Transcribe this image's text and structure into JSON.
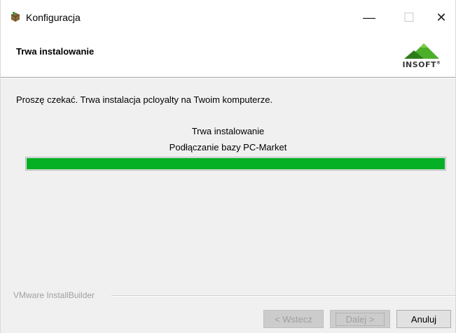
{
  "window": {
    "title": "Konfiguracja",
    "controls": {
      "minimize": "—",
      "maximize": "☐",
      "close": "✕"
    }
  },
  "header": {
    "title": "Trwa instalowanie",
    "logo_text": "INSOFT",
    "logo_mark": "®"
  },
  "body": {
    "message": "Proszę czekać. Trwa instalacja pcloyalty na Twoim komputerze.",
    "status_title": "Trwa instalowanie",
    "status_detail": "Podłączanie bazy PC-Market",
    "progress_percent": 100
  },
  "footer": {
    "brand": "VMware InstallBuilder",
    "buttons": {
      "back": "< Wstecz",
      "next": "Dalej >",
      "cancel": "Anuluj"
    }
  },
  "colors": {
    "progress": "#06b025",
    "logo_green": "#4caf2a",
    "logo_dark": "#2e7d1a"
  },
  "icons": {
    "app": "installer-box-icon",
    "logo": "insoft-mountain-logo"
  }
}
